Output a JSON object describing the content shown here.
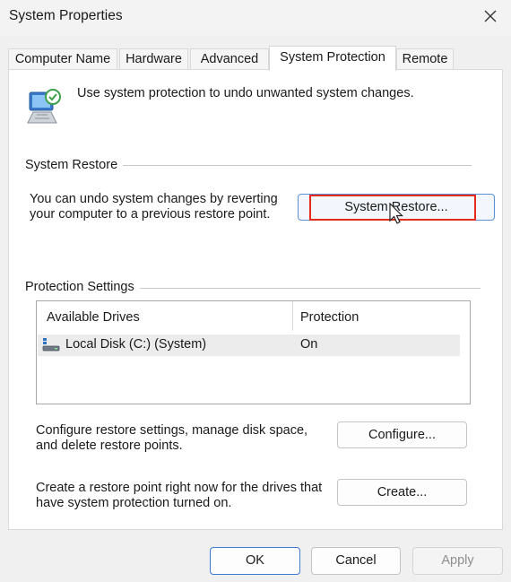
{
  "window": {
    "title": "System Properties"
  },
  "tabs": [
    {
      "label": "Computer Name"
    },
    {
      "label": "Hardware"
    },
    {
      "label": "Advanced"
    },
    {
      "label": "System Protection",
      "active": true
    },
    {
      "label": "Remote"
    }
  ],
  "intro": {
    "text": "Use system protection to undo unwanted system changes."
  },
  "system_restore": {
    "heading": "System Restore",
    "description_line1": "You can undo system changes by reverting",
    "description_line2": "your computer to a previous restore point.",
    "button_label": "System Restore..."
  },
  "protection_settings": {
    "heading": "Protection Settings",
    "columns": [
      "Available Drives",
      "Protection"
    ],
    "drives": [
      {
        "name": "Local Disk (C:) (System)",
        "protection": "On"
      }
    ],
    "configure_text_line1": "Configure restore settings, manage disk space,",
    "configure_text_line2": "and delete restore points.",
    "configure_button": "Configure...",
    "create_text_line1": "Create a restore point right now for the drives that",
    "create_text_line2": "have system protection turned on.",
    "create_button": "Create..."
  },
  "footer": {
    "ok": "OK",
    "cancel": "Cancel",
    "apply": "Apply"
  },
  "colors": {
    "highlight": "#e32b1d",
    "accent": "#3d7ad4"
  }
}
